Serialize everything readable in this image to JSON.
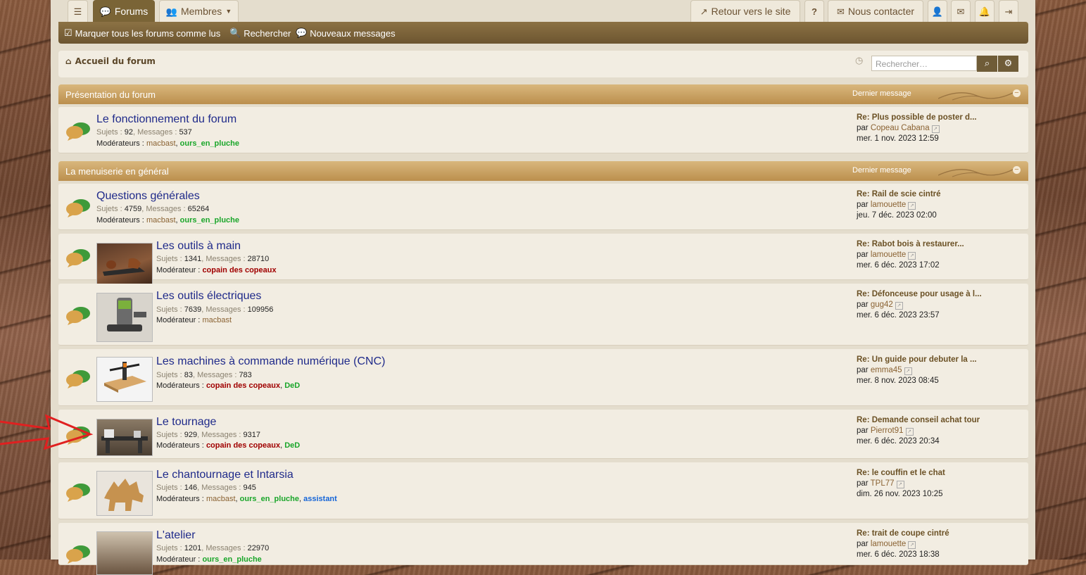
{
  "nav": {
    "forums": "Forums",
    "members": "Membres",
    "back_to_site": "Retour vers le site",
    "contact": "Nous contacter"
  },
  "subnav": {
    "mark_read": "Marquer tous les forums comme lus",
    "search": "Rechercher",
    "new_posts": "Nouveaux messages"
  },
  "breadcrumb": {
    "home": "Accueil du forum"
  },
  "search": {
    "placeholder": "Rechercher…"
  },
  "labels": {
    "subjects": "Sujets :",
    "messages": "Messages :",
    "moderators": "Modérateurs :",
    "moderator": "Modérateur :",
    "by": "par",
    "last_message": "Dernier message"
  },
  "categories": [
    {
      "title": "Présentation du forum"
    },
    {
      "title": "La menuiserie en général"
    }
  ],
  "forums": [
    {
      "title": "Le fonctionnement du forum",
      "subjects": "92",
      "messages": "537",
      "last_title": "Re: Plus possible de poster d...",
      "last_user": "Copeau Cabana",
      "last_date": "mer. 1 nov. 2023 12:59"
    },
    {
      "title": "Questions générales",
      "subjects": "4759",
      "messages": "65264",
      "last_title": "Re: Rail de scie cintré",
      "last_user": "lamouette",
      "last_date": "jeu. 7 déc. 2023 02:00"
    },
    {
      "title": "Les outils à main",
      "subjects": "1341",
      "messages": "28710",
      "last_title": "Re: Rabot bois à restaurer...",
      "last_user": "lamouette",
      "last_date": "mer. 6 déc. 2023 17:02"
    },
    {
      "title": "Les outils électriques",
      "subjects": "7639",
      "messages": "109956",
      "last_title": "Re: Défonceuse pour usage à l...",
      "last_user": "gug42",
      "last_date": "mer. 6 déc. 2023 23:57"
    },
    {
      "title": "Les machines à commande numérique (CNC)",
      "subjects": "83",
      "messages": "783",
      "last_title": "Re: Un guide pour debuter la ...",
      "last_user": "emma45",
      "last_date": "mer. 8 nov. 2023 08:45"
    },
    {
      "title": "Le tournage",
      "subjects": "929",
      "messages": "9317",
      "last_title": "Re: Demande conseil achat tour",
      "last_user": "Pierrot91",
      "last_date": "mer. 6 déc. 2023 20:34"
    },
    {
      "title": "Le chantournage et Intarsia",
      "subjects": "146",
      "messages": "945",
      "last_title": "Re: le couffin et le chat",
      "last_user": "TPL77",
      "last_date": "dim. 26 nov. 2023 10:25"
    },
    {
      "title": "L'atelier",
      "subjects": "1201",
      "messages": "22970",
      "last_title": "Re: trait de coupe cintré",
      "last_user": "lamouette",
      "last_date": "mer. 6 déc. 2023 18:38"
    }
  ],
  "mods": {
    "macbast": "macbast",
    "ours": "ours_en_pluche",
    "copain": "copain des copeaux",
    "ded": "DeD",
    "assistant": "assistant"
  },
  "colors": {
    "accent": "#7a6436",
    "category": "#c9a063",
    "title_link": "#1f2a8a"
  }
}
